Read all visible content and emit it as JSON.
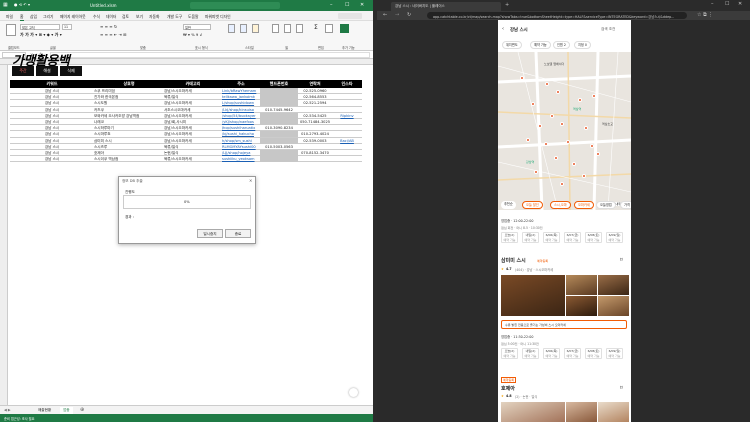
{
  "excel": {
    "title": "Untitled.xlsm",
    "menu": [
      "파일",
      "홈",
      "삽입",
      "그리기",
      "페이지 레이아웃",
      "수식",
      "데이터",
      "검토",
      "보기",
      "자동화",
      "개발 도구",
      "도움말",
      "파워피벗 디자인"
    ],
    "font_name": "맑은 고딕",
    "font_size": "11",
    "number_format": "일반",
    "ribbon_groups": [
      "클립보드",
      "글꼴",
      "맞춤",
      "표시 형식",
      "스타일",
      "셀",
      "편집",
      "추가 기능"
    ],
    "logo": "가맹활용백",
    "tabs": [
      "주간",
      "해설",
      "식제"
    ],
    "columns": [
      "키워드",
      "상호명",
      "카테고리",
      "주소",
      "핸드폰번호",
      "연락처",
      "인스타"
    ],
    "rows": [
      [
        "강남 스시",
        "스쿠 프리미엄",
        "강남/스시오마카세",
        "Link/bRawYhemam",
        "",
        "02-525-0960",
        ""
      ],
      [
        "강남 스시",
        "진가와 한국본점",
        "육류/일식",
        "tellkawa_jankoimk",
        "",
        "02-564-8553",
        ""
      ],
      [
        "강남 스시",
        "스시도원",
        "강남/스시오마카세",
        "L/shop/sushidown",
        "",
        "02-521-2594",
        ""
      ],
      [
        "강남 스시",
        "카츠쿠",
        "서초스시오마카세",
        "/LkJ/shop/kinsuiso",
        "010-7445-9642",
        "",
        ""
      ],
      [
        "강남 스시",
        "모와카세 오사카조방 강남역점",
        "강남/스시오마카세",
        "/shop/54/buokayer",
        "",
        "02-534-5425",
        "Ripkinv"
      ],
      [
        "강남 스시",
        "나래코",
        "강남/회,사시미",
        "/yKJ/shop/naefxos",
        "",
        "050-71484-3025",
        ""
      ],
      [
        "강남 스시",
        "스시하루마기",
        "강남/스시오마카세",
        "Jhop/sushiharuatix",
        "010-3090-8234",
        "",
        ""
      ],
      [
        "강남 스시",
        "스시마루쵸",
        "강남/스시오마카세",
        "/bj/sushi_hakucho",
        "",
        "010-2793-4024",
        ""
      ],
      [
        "강남 스시",
        "삼미미 스시",
        "강남/스시오마카세",
        "h/shop/sm_sushi",
        "",
        "02-539-0003",
        "Baci/AB"
      ],
      [
        "강남 스시",
        "스시즈루",
        "육류/일식",
        "RLMGMYAYsushi00",
        "010-5003-0563",
        "",
        ""
      ],
      [
        "강남 스시",
        "호제아",
        "논현/일식",
        "/LJJ/shop/hojeya",
        "",
        "070-8152-3470",
        ""
      ],
      [
        "강남 스시",
        "스시이쿠 역삼점",
        "육류/스시오마카세",
        "sushiiku_yeoksam",
        "",
        "",
        ""
      ]
    ],
    "dialog": {
      "title": "정보 DB 추출",
      "status_label": "진행도",
      "progress": "0%",
      "elapsed_label": "경과 :",
      "stop_button": "일시중지",
      "close_button": "종료"
    },
    "sheet_tabs": [
      "매출현황",
      "업종"
    ],
    "status": "준비  접근성: 조사 필요"
  },
  "browser": {
    "tab_title": "강남 스시 : 네이버지도 | 플레이스",
    "url": "app.catchtable.co.kr/ct/map/search-map?showTabs=true&bottomSheetHeight=type=HALF&serviceType=INTEGRATED&keyword=강남스시&ddep...",
    "search_value": "강남 스시",
    "search_action": "검색 조건",
    "filter_chips": [
      "위치편도",
      "예약 가능",
      "인원 2",
      "지정 0"
    ],
    "map_labels": [
      "노보텔 앰배서더",
      "역삼역",
      "역삼초교",
      "강남역"
    ],
    "list_chips": [
      "추천순",
      "오늘 할인",
      "스시,오마",
      "오마카세",
      "오늘영업",
      "가격"
    ],
    "entries": [
      {
        "open": "영업중 · 12:00-22:00",
        "sub": "점심 회전 · 머니 8.5 · 10:30전",
        "times": [
          "오늘(2)",
          "내일(2)",
          "6/06(목)",
          "6/07(금)",
          "6/08(토)",
          "6/09(일)"
        ],
        "counts": [
          "예약 가능",
          "예약 가능",
          "예약 가능",
          "예약 가능",
          "예약 가능",
          "예약 가능"
        ]
      },
      {
        "name": "삼미미 스시",
        "badge": "예약등록",
        "rating": "4.7",
        "review": "(404) · 강남 · 스시오마카세",
        "promo": "수류 밝힌 전용으로 즐기는 가성비 스시 오마카세",
        "open": "영업중 · 11:30-22:00",
        "sub": "점심 5:00전 · 머니 11:30전",
        "times": [
          "오늘(2)",
          "내일(2)",
          "6/06(목)",
          "6/07(금)",
          "6/08(토)",
          "6/09(일)"
        ],
        "counts": [
          "예약 가능",
          "예약 가능",
          "예약 가능",
          "예약 가능",
          "예약 가능",
          "예약 가능"
        ]
      },
      {
        "name": "호제아",
        "badge": "예약등록",
        "rating": "4.8",
        "review": "(2) · 논현 · 일식"
      }
    ],
    "colors": {
      "accent": "#f25c05",
      "excel_green": "#1f7a45"
    }
  }
}
